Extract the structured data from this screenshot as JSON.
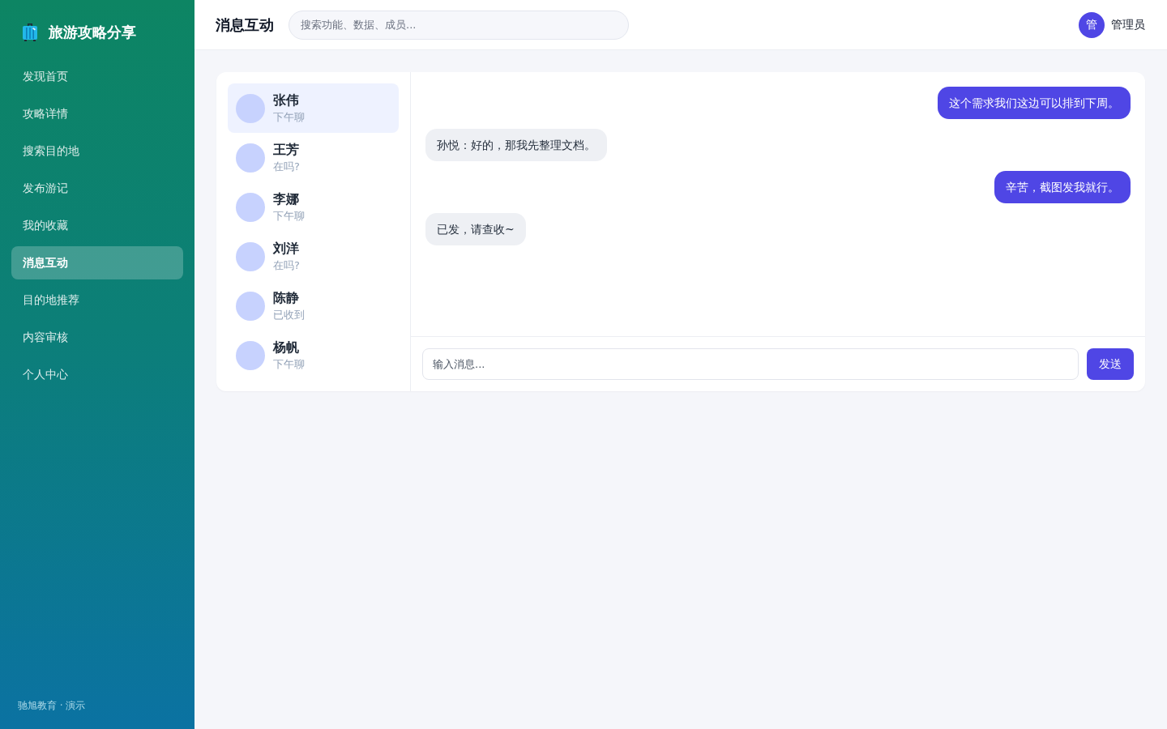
{
  "sidebar": {
    "brand": {
      "title": "旅游攻略分享"
    },
    "items": [
      {
        "label": "发现首页",
        "selected": false
      },
      {
        "label": "攻略详情",
        "selected": false
      },
      {
        "label": "搜索目的地",
        "selected": false
      },
      {
        "label": "发布游记",
        "selected": false
      },
      {
        "label": "我的收藏",
        "selected": false
      },
      {
        "label": "消息互动",
        "selected": true
      },
      {
        "label": "目的地推荐",
        "selected": false
      },
      {
        "label": "内容审核",
        "selected": false
      },
      {
        "label": "个人中心",
        "selected": false
      }
    ],
    "footer": "驰旭教育 · 演示"
  },
  "header": {
    "title": "消息互动",
    "search": {
      "placeholder": "搜索功能、数据、成员..."
    },
    "user": {
      "avatar_text": "管",
      "name": "管理员"
    }
  },
  "contacts": [
    {
      "name": "张伟",
      "preview": "下午聊",
      "selected": true
    },
    {
      "name": "王芳",
      "preview": "在吗?",
      "selected": false
    },
    {
      "name": "李娜",
      "preview": "下午聊",
      "selected": false
    },
    {
      "name": "刘洋",
      "preview": "在吗?",
      "selected": false
    },
    {
      "name": "陈静",
      "preview": "已收到",
      "selected": false
    },
    {
      "name": "杨帆",
      "preview": "下午聊",
      "selected": false
    }
  ],
  "messages": [
    {
      "kind": "outgoing",
      "text": "这个需求我们这边可以排到下周。"
    },
    {
      "kind": "incoming",
      "text": "孙悦：好的，那我先整理文档。"
    },
    {
      "kind": "outgoing",
      "text": "辛苦，截图发我就行。"
    },
    {
      "kind": "incoming",
      "text": "已发，请查收~"
    }
  ],
  "composer": {
    "placeholder": "输入消息...",
    "button": "发送"
  }
}
